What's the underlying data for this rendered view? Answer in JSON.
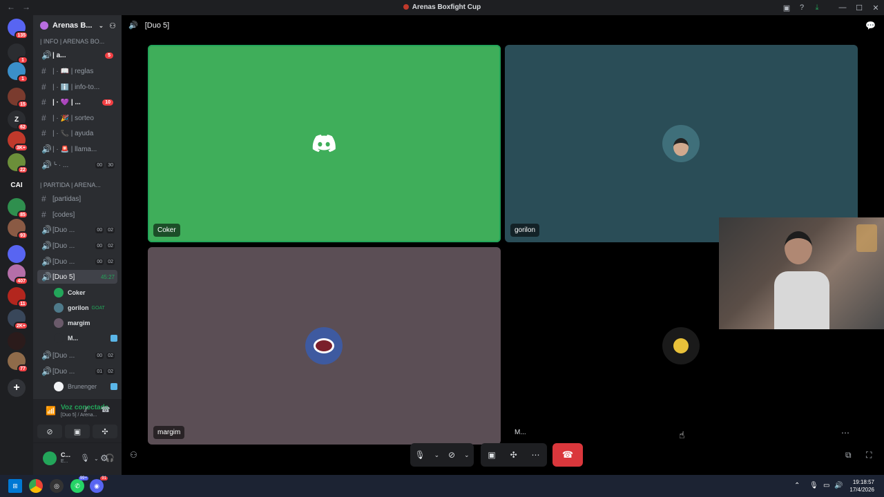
{
  "window": {
    "title": "Arenas Boxfight Cup"
  },
  "guilds": [
    {
      "badge": "135",
      "color": "#5865f2",
      "label": ""
    },
    {
      "badge": "1",
      "color": "#2b2d31",
      "label": ""
    },
    {
      "badge": "1",
      "color": "#3b8fc9",
      "label": ""
    },
    {
      "badge": "15",
      "color": "#7a3b2e",
      "label": ""
    },
    {
      "badge": "62",
      "color": "#2b2d31",
      "label": "Z"
    },
    {
      "badge": "3K+",
      "color": "#c0392b",
      "label": ""
    },
    {
      "badge": "22",
      "color": "#6c8f3a",
      "label": ""
    },
    {
      "badge": "",
      "color": "#1e1f22",
      "label": "CAI"
    },
    {
      "badge": "85",
      "color": "#2f8f4e",
      "label": ""
    },
    {
      "badge": "93",
      "color": "#8a5a44",
      "label": ""
    },
    {
      "badge": "",
      "color": "#5865f2",
      "label": ""
    },
    {
      "badge": "407",
      "color": "#b56fa8",
      "label": ""
    },
    {
      "badge": "11",
      "color": "#b3261e",
      "label": ""
    },
    {
      "badge": "2K+",
      "color": "#39475a",
      "label": ""
    },
    {
      "badge": "",
      "color": "#2b1b1b",
      "label": ""
    },
    {
      "badge": "77",
      "color": "#8f6b4a",
      "label": ""
    }
  ],
  "server": {
    "name": "Arenas B..."
  },
  "categories": [
    {
      "label": "| INFO | ARENAS BO..."
    },
    {
      "label": "| PARTIDA | ARENA..."
    }
  ],
  "channels": [
    {
      "icon": "🔊",
      "label": "| a...",
      "badge": "5",
      "unread": true
    },
    {
      "icon": "#",
      "label": "| · 📖 | reglas",
      "badge": "",
      "unread": false
    },
    {
      "icon": "#",
      "label": "| · ℹ️ | info-to...",
      "badge": "",
      "unread": false
    },
    {
      "icon": "#",
      "label": "| · 💜 | ...",
      "badge": "10",
      "unread": true
    },
    {
      "icon": "#",
      "label": "| · 🎉 | sorteo",
      "badge": "",
      "unread": false
    },
    {
      "icon": "#",
      "label": "| · 📞 | ayuda",
      "badge": "",
      "unread": false
    },
    {
      "icon": "🔊",
      "label": "| · 🚨 | llama...",
      "badge": "",
      "unread": false
    },
    {
      "icon": "🔊",
      "label": "╰ · ...",
      "c1": "00",
      "c2": "30"
    },
    {
      "icon": "#",
      "label": "[partidas]",
      "badge": "",
      "unread": false
    },
    {
      "icon": "#",
      "label": "[codes]",
      "badge": "",
      "unread": false
    },
    {
      "icon": "🔊",
      "label": "[Duo ...",
      "c1": "00",
      "c2": "02"
    },
    {
      "icon": "🔊",
      "label": "[Duo ...",
      "c1": "00",
      "c2": "02"
    },
    {
      "icon": "🔊",
      "label": "[Duo ...",
      "c1": "00",
      "c2": "02"
    },
    {
      "icon": "🔊",
      "label": "[Duo 5]",
      "timer": "45:27"
    },
    {
      "icon": "🔊",
      "label": "[Duo ...",
      "c1": "00",
      "c2": "02"
    },
    {
      "icon": "🔊",
      "label": "[Duo ...",
      "c1": "01",
      "c2": "02"
    }
  ],
  "voice_members": [
    {
      "name": "Coker",
      "tag": "",
      "color": "#23a55a",
      "live": false
    },
    {
      "name": "gorilon",
      "tag": "GOAT",
      "color": "#4e7a8a",
      "live": false
    },
    {
      "name": "margim",
      "tag": "",
      "color": "#6a5a6a",
      "live": false
    },
    {
      "name": "M...",
      "tag": "",
      "color": "#2b2d31",
      "live": true
    }
  ],
  "extra_member": {
    "name": "Brunenger"
  },
  "voice_status": {
    "title": "Voz conectada",
    "subtitle": "[Duo 5] / Arena..."
  },
  "user": {
    "name": "C...",
    "status": "E..."
  },
  "stage": {
    "channel": "[Duo 5]"
  },
  "tiles": [
    {
      "name": "Coker",
      "bg": "#3fae5a"
    },
    {
      "name": "gorilon",
      "bg": "#2a4d57"
    },
    {
      "name": "margim",
      "bg": "#5b4e55"
    },
    {
      "name": "M...",
      "bg": "#000000"
    }
  ],
  "taskbar": {
    "time": "19:18:57",
    "date": "17/4/2026",
    "badge1": "99+",
    "badge2": "91"
  }
}
